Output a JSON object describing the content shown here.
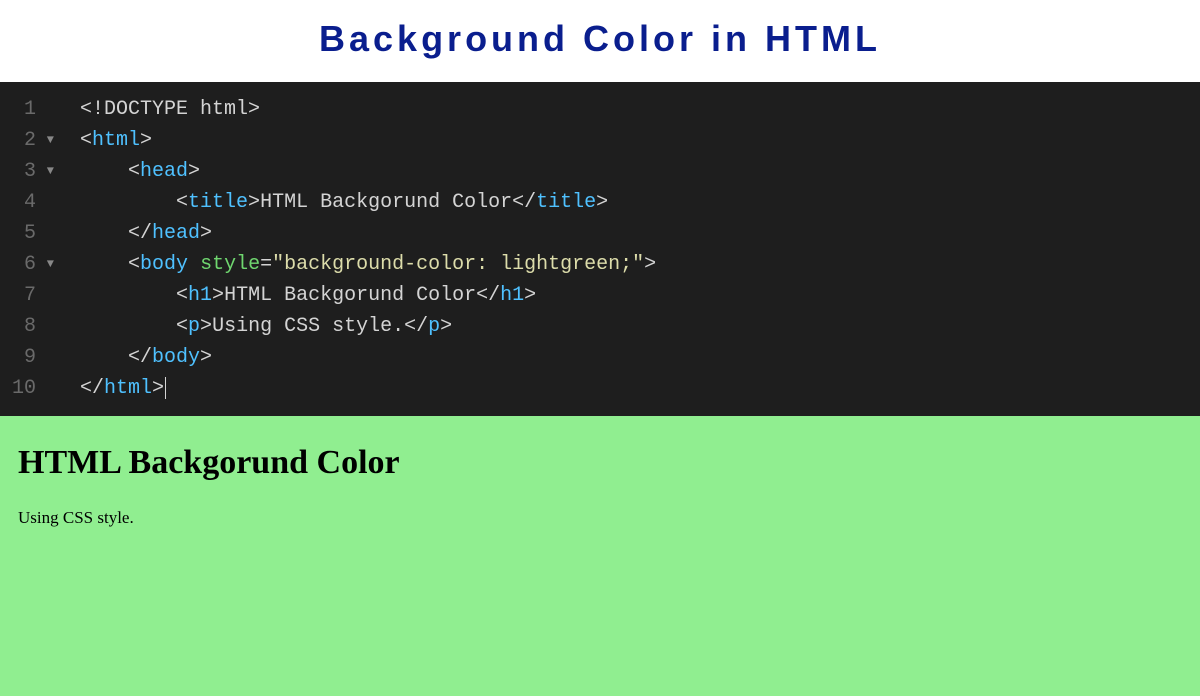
{
  "header": {
    "title": "Background Color in HTML"
  },
  "editor": {
    "lines": [
      {
        "num": "1",
        "fold": "",
        "indent": "",
        "tokens": [
          {
            "t": "doctype",
            "v": "<!DOCTYPE html>"
          }
        ]
      },
      {
        "num": "2",
        "fold": "▼",
        "indent": "",
        "tokens": [
          {
            "t": "tag-bracket",
            "v": "<"
          },
          {
            "t": "tag-name",
            "v": "html"
          },
          {
            "t": "tag-bracket",
            "v": ">"
          }
        ]
      },
      {
        "num": "3",
        "fold": "▼",
        "indent": "    ",
        "tokens": [
          {
            "t": "tag-bracket",
            "v": "<"
          },
          {
            "t": "tag-name",
            "v": "head"
          },
          {
            "t": "tag-bracket",
            "v": ">"
          }
        ]
      },
      {
        "num": "4",
        "fold": "",
        "indent": "        ",
        "tokens": [
          {
            "t": "tag-bracket",
            "v": "<"
          },
          {
            "t": "tag-name",
            "v": "title"
          },
          {
            "t": "tag-bracket",
            "v": ">"
          },
          {
            "t": "text-content",
            "v": "HTML Backgorund Color"
          },
          {
            "t": "tag-bracket",
            "v": "</"
          },
          {
            "t": "tag-name",
            "v": "title"
          },
          {
            "t": "tag-bracket",
            "v": ">"
          }
        ]
      },
      {
        "num": "5",
        "fold": "",
        "indent": "    ",
        "tokens": [
          {
            "t": "tag-bracket",
            "v": "</"
          },
          {
            "t": "tag-name",
            "v": "head"
          },
          {
            "t": "tag-bracket",
            "v": ">"
          }
        ]
      },
      {
        "num": "6",
        "fold": "▼",
        "indent": "    ",
        "tokens": [
          {
            "t": "tag-bracket",
            "v": "<"
          },
          {
            "t": "tag-name",
            "v": "body"
          },
          {
            "t": "text-content",
            "v": " "
          },
          {
            "t": "attr-name",
            "v": "style"
          },
          {
            "t": "tag-bracket",
            "v": "="
          },
          {
            "t": "attr-value",
            "v": "\"background-color: lightgreen;\""
          },
          {
            "t": "tag-bracket",
            "v": ">"
          }
        ]
      },
      {
        "num": "7",
        "fold": "",
        "indent": "        ",
        "tokens": [
          {
            "t": "tag-bracket",
            "v": "<"
          },
          {
            "t": "tag-name",
            "v": "h1"
          },
          {
            "t": "tag-bracket",
            "v": ">"
          },
          {
            "t": "text-content",
            "v": "HTML Backgorund Color"
          },
          {
            "t": "tag-bracket",
            "v": "</"
          },
          {
            "t": "tag-name",
            "v": "h1"
          },
          {
            "t": "tag-bracket",
            "v": ">"
          }
        ]
      },
      {
        "num": "8",
        "fold": "",
        "indent": "        ",
        "tokens": [
          {
            "t": "tag-bracket",
            "v": "<"
          },
          {
            "t": "tag-name",
            "v": "p"
          },
          {
            "t": "tag-bracket",
            "v": ">"
          },
          {
            "t": "text-content",
            "v": "Using CSS style."
          },
          {
            "t": "tag-bracket",
            "v": "</"
          },
          {
            "t": "tag-name",
            "v": "p"
          },
          {
            "t": "tag-bracket",
            "v": ">"
          }
        ]
      },
      {
        "num": "9",
        "fold": "",
        "indent": "    ",
        "tokens": [
          {
            "t": "tag-bracket",
            "v": "</"
          },
          {
            "t": "tag-name",
            "v": "body"
          },
          {
            "t": "tag-bracket",
            "v": ">"
          }
        ]
      },
      {
        "num": "10",
        "fold": "",
        "indent": "",
        "tokens": [
          {
            "t": "tag-bracket",
            "v": "</"
          },
          {
            "t": "tag-name",
            "v": "html"
          },
          {
            "t": "tag-bracket",
            "v": ">"
          }
        ],
        "cursor": true
      }
    ]
  },
  "preview": {
    "heading": "HTML Backgorund Color",
    "paragraph": "Using CSS style.",
    "bgcolor": "#90ee90"
  }
}
